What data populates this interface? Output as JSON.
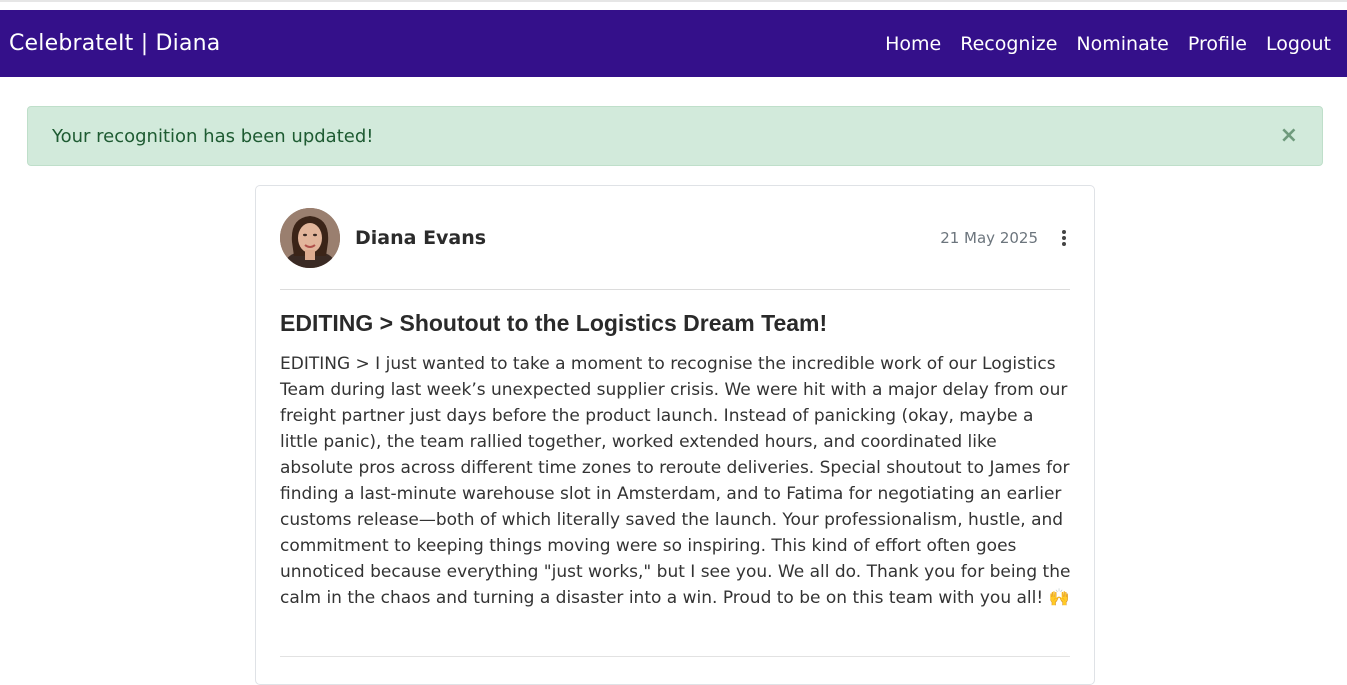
{
  "navbar": {
    "brand": "CelebrateIt | Diana",
    "links": [
      "Home",
      "Recognize",
      "Nominate",
      "Profile",
      "Logout"
    ]
  },
  "alert": {
    "message": "Your recognition has been updated!",
    "close_icon": "×"
  },
  "post": {
    "author": "Diana Evans",
    "date": "21 May 2025",
    "title": "EDITING > Shoutout to the Logistics Dream Team!",
    "body": "EDITING > I just wanted to take a moment to recognise the incredible work of our Logistics Team during last week’s unexpected supplier crisis. We were hit with a major delay from our freight partner just days before the product launch. Instead of panicking (okay, maybe a little panic), the team rallied together, worked extended hours, and coordinated like absolute pros across different time zones to reroute deliveries. Special shoutout to James for finding a last-minute warehouse slot in Amsterdam, and to Fatima for negotiating an earlier customs release—both of which literally saved the launch. Your professionalism, hustle, and commitment to keeping things moving were so inspiring. This kind of effort often goes unnoticed because everything \"just works,\" but I see you. We all do. Thank you for being the calm in the chaos and turning a disaster into a win. Proud to be on this team with you all! 🙌"
  },
  "colors": {
    "navbar_bg": "#34108a",
    "alert_bg": "#d2eadb",
    "alert_text": "#1e5b32"
  }
}
